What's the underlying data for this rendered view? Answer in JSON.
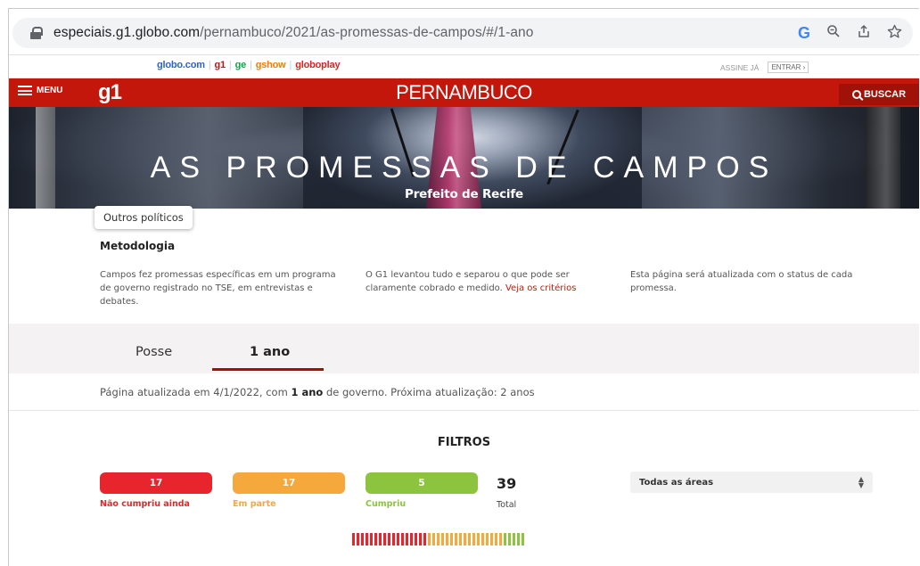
{
  "browser": {
    "url_domain": "especiais.g1.globo.com",
    "url_path": "/pernambuco/2021/as-promessas-de-campos/#/1-ano",
    "google_icon": "G"
  },
  "globobar": {
    "links": [
      {
        "label": "globo.com",
        "color": "#2c65c2"
      },
      {
        "label": "g1",
        "color": "#c4170c"
      },
      {
        "label": "ge",
        "color": "#06aa48"
      },
      {
        "label": "gshow",
        "color": "#f67b00"
      },
      {
        "label": "globoplay",
        "color": "#e2211c"
      }
    ],
    "assine": "ASSINE JÁ",
    "entrar": "ENTRAR ›"
  },
  "header": {
    "menu_label": "MENU",
    "logo": "g1",
    "state": "PERNAMBUCO",
    "search_label": "BUSCAR"
  },
  "hero": {
    "title": "AS PROMESSAS DE CAMPOS",
    "subtitle": "Prefeito de Recife"
  },
  "outros_button": "Outros políticos",
  "methodology": {
    "title": "Metodologia",
    "col1": "Campos fez promessas específicas em um programa de governo registrado no TSE, em entrevistas e debates.",
    "col2_text": "O G1 levantou tudo e separou o que pode ser claramente cobrado e medido.",
    "col2_link": "Veja os critérios",
    "col3": "Esta página será atualizada com o status de cada promessa."
  },
  "tabs": [
    {
      "label": "Posse",
      "active": false
    },
    {
      "label": "1 ano",
      "active": true
    }
  ],
  "update": {
    "prefix": "Página atualizada em 4/1/2022, com ",
    "bold": "1 ano",
    "suffix": " de governo. Próxima atualização: 2 anos"
  },
  "filters": {
    "title": "FILTROS",
    "items": [
      {
        "count": "17",
        "label": "Não cumpriu ainda",
        "color": "#e8252d"
      },
      {
        "count": "17",
        "label": "Em parte",
        "color": "#f5a83c"
      },
      {
        "count": "5",
        "label": "Cumpriu",
        "color": "#8cc43f"
      }
    ],
    "total": "39",
    "total_label": "Total",
    "area_select": "Todas as áreas"
  },
  "colors": {
    "brand_red": "#c4170c",
    "not_fulfilled": "#e8252d",
    "partial": "#f5a83c",
    "fulfilled": "#8cc43f"
  }
}
